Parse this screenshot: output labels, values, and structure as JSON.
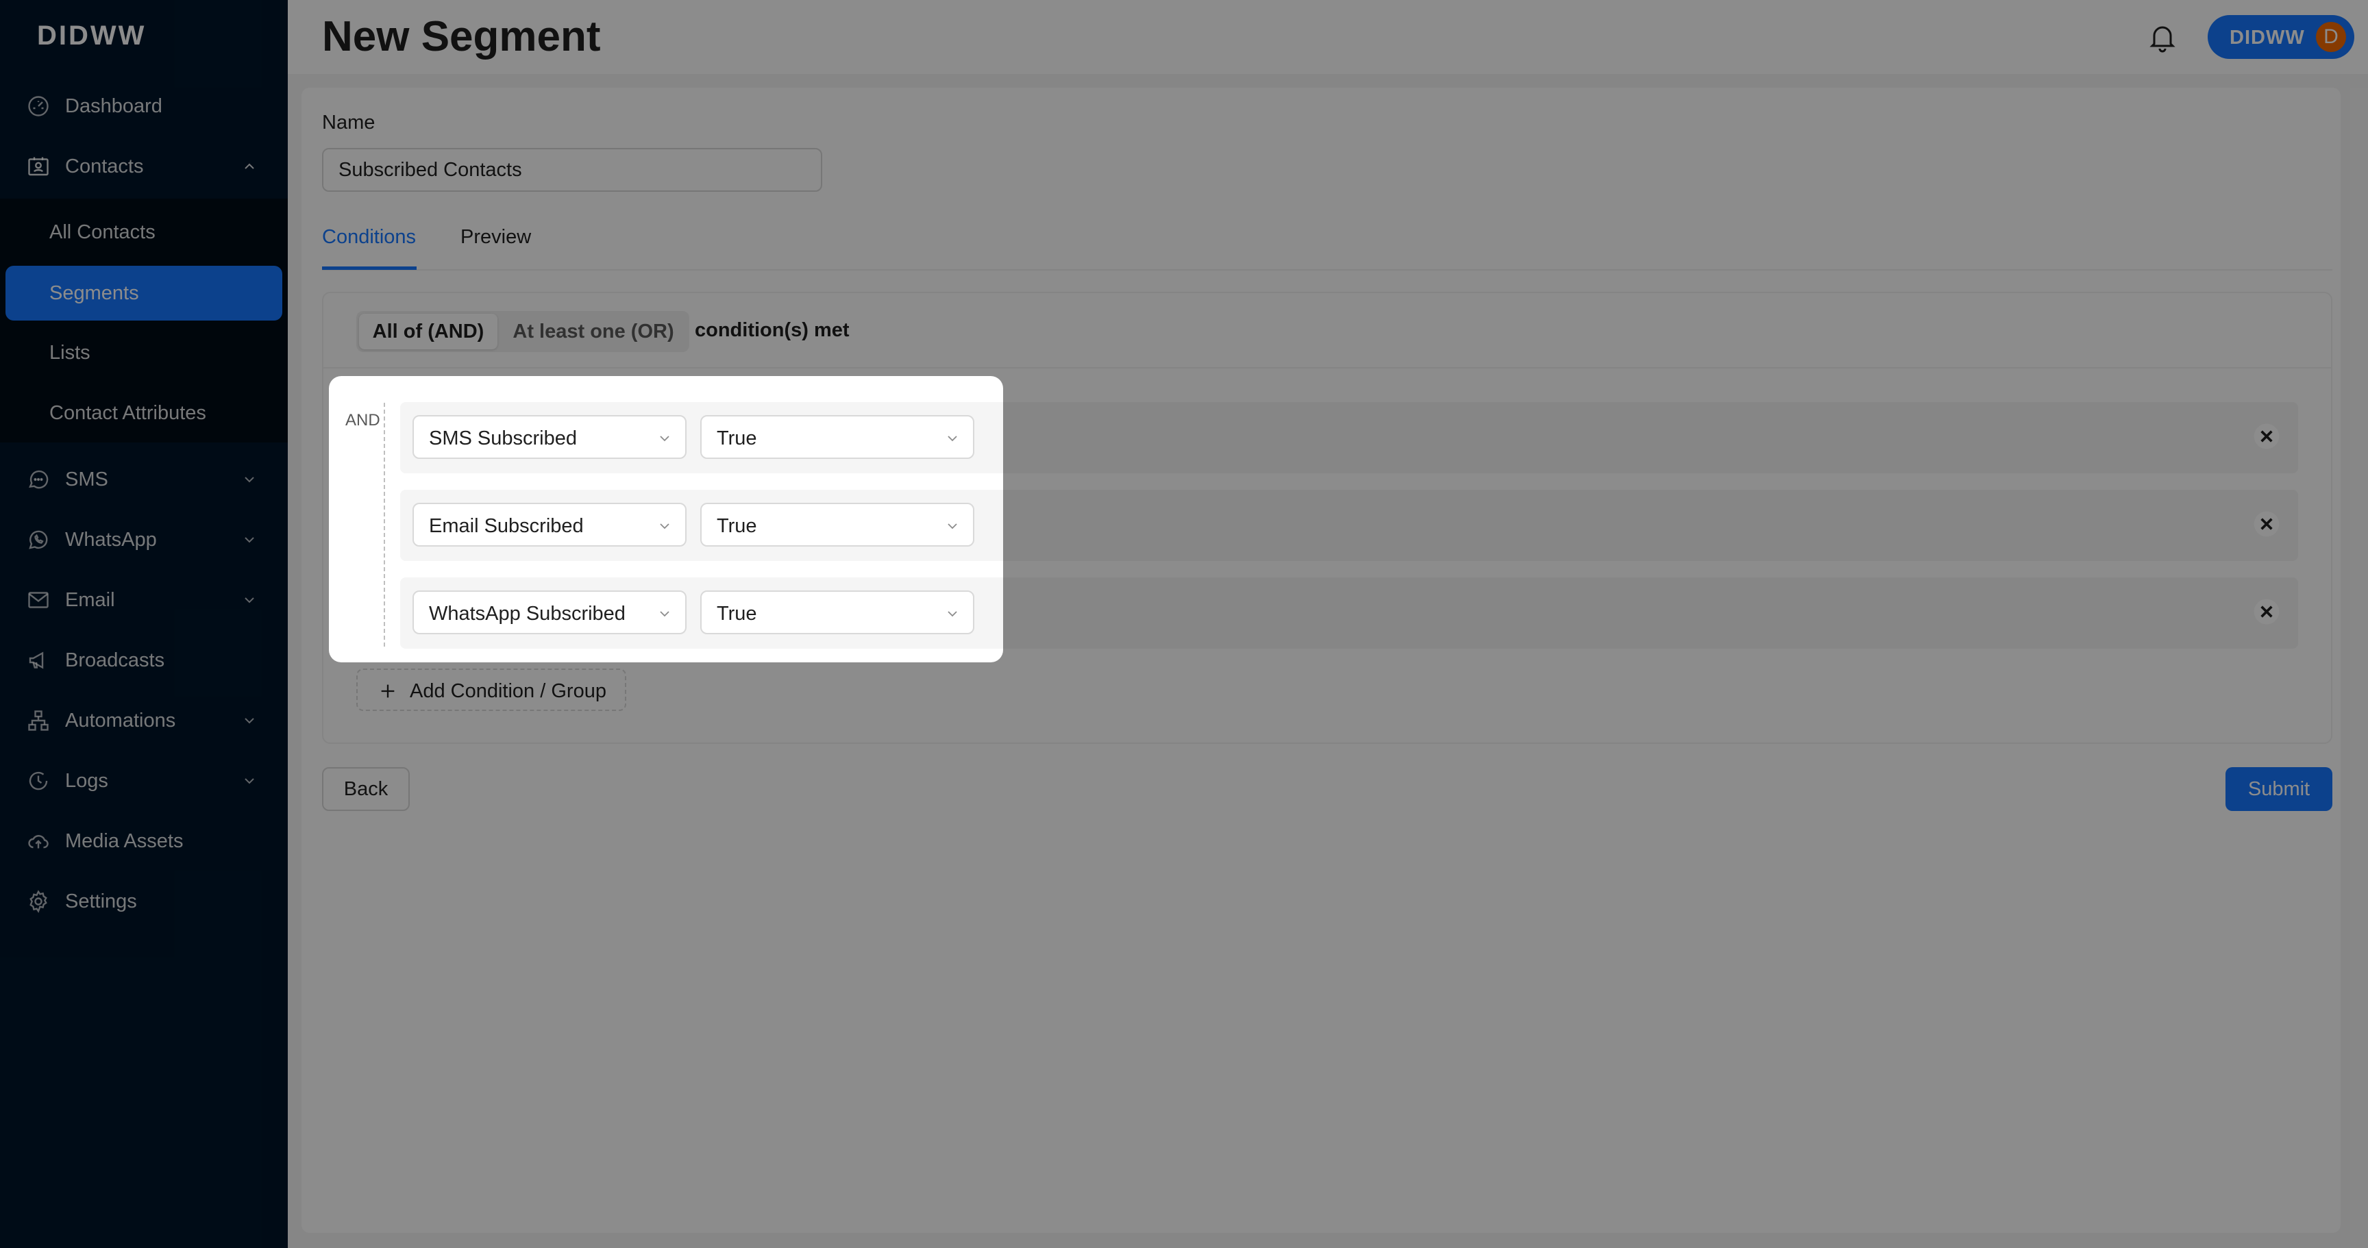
{
  "app": {
    "logo": "DIDWW"
  },
  "header": {
    "title": "New Segment",
    "user": {
      "name": "DIDWW",
      "initial": "D"
    }
  },
  "sidebar": {
    "items": [
      {
        "label": "Dashboard",
        "icon": "dashboard-icon"
      },
      {
        "label": "Contacts",
        "icon": "contacts-icon",
        "expanded": true
      },
      {
        "label": "SMS",
        "icon": "chat-icon"
      },
      {
        "label": "WhatsApp",
        "icon": "whatsapp-icon"
      },
      {
        "label": "Email",
        "icon": "mail-icon"
      },
      {
        "label": "Broadcasts",
        "icon": "megaphone-icon"
      },
      {
        "label": "Automations",
        "icon": "flow-icon"
      },
      {
        "label": "Logs",
        "icon": "history-icon"
      },
      {
        "label": "Media Assets",
        "icon": "cloud-upload-icon"
      },
      {
        "label": "Settings",
        "icon": "gear-icon"
      }
    ],
    "contacts_sub": [
      {
        "label": "All Contacts"
      },
      {
        "label": "Segments",
        "active": true
      },
      {
        "label": "Lists"
      },
      {
        "label": "Contact Attributes"
      }
    ]
  },
  "form": {
    "name_label": "Name",
    "name_value": "Subscribed Contacts",
    "tabs": [
      {
        "label": "Conditions",
        "active": true
      },
      {
        "label": "Preview"
      }
    ],
    "match": {
      "options": [
        "All of (AND)",
        "At least one (OR)"
      ],
      "selected": "All of (AND)",
      "suffix": "condition(s) met"
    },
    "operator_label": "AND",
    "conditions": [
      {
        "field": "SMS Subscribed",
        "value": "True"
      },
      {
        "field": "Email Subscribed",
        "value": "True"
      },
      {
        "field": "WhatsApp Subscribed",
        "value": "True"
      }
    ],
    "add_label": "Add Condition / Group",
    "back_label": "Back",
    "submit_label": "Submit"
  },
  "colors": {
    "primary": "#1677ff",
    "sidebar": "#001529",
    "avatar": "#f56a00"
  }
}
